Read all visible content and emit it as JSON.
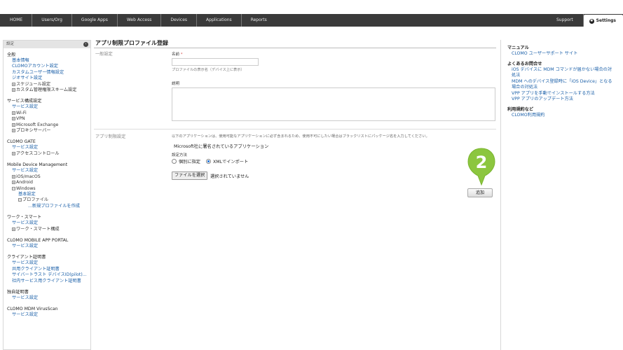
{
  "nav": {
    "items": [
      "HOME",
      "Users/Org",
      "Google Apps",
      "Web Access",
      "Devices",
      "Applications",
      "Reports"
    ],
    "support": "Support",
    "settings": "Settings",
    "settings_icon": "gear-icon"
  },
  "sidebar": {
    "header": "設定",
    "collapse_icon": "chevron-left-icon",
    "groups": {
      "general": {
        "title": "全般",
        "items": [
          "基本情報",
          "CLOMOアカウント設定",
          "カスタムユーザー情報設定",
          "ジオサイト設定"
        ],
        "tree": [
          "スケジュール設定",
          "カスタム管理権限スキーム設定"
        ]
      },
      "service": {
        "title": "サービス構成設定",
        "items": [
          "サービス設定"
        ],
        "tree": [
          "Wi-Fi",
          "VPN",
          "Microsoft Exchange",
          "プロキシサーバー"
        ]
      },
      "gate": {
        "title": "CLOMO GATE",
        "items": [
          "サービス設定"
        ],
        "tree": [
          "アクセスコントロール"
        ]
      },
      "mdm": {
        "title": "Mobile Device Management",
        "items": [
          "サービス設定"
        ],
        "tree": [
          "iOS/macOS",
          "Android",
          "Windows"
        ],
        "windows_base": "基本設定",
        "profile": "プロファイル",
        "new_profile": "...新規プロファイルを作成"
      },
      "work": {
        "title": "ワーク・スマート",
        "items": [
          "サービス設定"
        ],
        "tree": [
          "ワーク・スマート構成"
        ]
      },
      "portal": {
        "title": "CLOMO MOBILE APP PORTAL",
        "items": [
          "サービス設定"
        ]
      },
      "client_cert": {
        "title": "クライアント証明書",
        "items": [
          "サービス設定",
          "共用クライアント証明書",
          "サイバートラスト デバイスID(pilot)...",
          "社内サービス用クライアント証明書"
        ]
      },
      "own_cert": {
        "title": "独自証明書",
        "items": [
          "サービス設定"
        ]
      },
      "virus": {
        "title": "CLOMO MDM VirusScan",
        "items": [
          "サービス設定"
        ]
      }
    }
  },
  "main": {
    "title": "アプリ制限プロファイル登録",
    "general_section": "一般設定",
    "name_label": "名前",
    "required_mark": "*",
    "name_value": "",
    "name_hint": "プロファイルの表示名（デバイス上に表示）",
    "desc_label": "説明",
    "desc_value": "",
    "app_section": "アプリ制限設定",
    "app_desc": "以下のアプリケーションは、使用可能なアプリケーションに必ず含まれるため、使用不可にしたい場合はブラックリストにパッケージ名を入力してください。",
    "ms_apps": "Microsoft社に署名されているアプリケーション",
    "method_label": "設定方法",
    "radio_individual": "個別に指定",
    "radio_xml": "XMLでインポート",
    "selected_method": "xml",
    "file_button": "ファイルを選択",
    "file_status": "選択されていません",
    "add_button": "追加",
    "step_number": "2"
  },
  "rpanel": {
    "manual_title": "マニュアル",
    "manual_links": [
      "CLOMO ユーザーサポート サイト"
    ],
    "faq_title": "よくあるお問合せ",
    "faq_links": [
      "iOS デバイスに MDM コマンドが届かない場合の対",
      "処法",
      "MDM へのデバイス登録時に「iOS Device」となる",
      "場合の対処法",
      "VPP アプリを手動でインストールする方法",
      "VPP アプリのアップデート方法"
    ],
    "terms_title": "利用規約など",
    "terms_links": [
      "CLOMO利用規約"
    ]
  },
  "colors": {
    "topbar": "#3a3a3a",
    "link": "#1a5fa8",
    "marker": "#8cc63f",
    "required": "#d9534f"
  }
}
